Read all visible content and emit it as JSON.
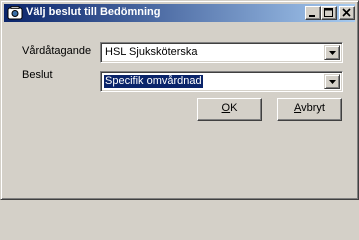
{
  "window": {
    "title": "Välj beslut till Bedömning",
    "controls": {
      "minimize_icon": "minimize-icon",
      "maximize_icon": "maximize-icon",
      "close_icon": "close-icon"
    }
  },
  "form": {
    "vardatagande": {
      "label": "Vårdåtagande",
      "value": "HSL Sjuksköterska"
    },
    "beslut": {
      "label": "Beslut",
      "value": "Specifik omvårdnad"
    }
  },
  "buttons": {
    "ok": {
      "mnemonic": "O",
      "rest": "K"
    },
    "avbryt": {
      "mnemonic": "A",
      "rest": "vbryt"
    }
  },
  "colors": {
    "title_start": "#0a246a",
    "title_end": "#a6caf0",
    "face": "#d4d0c8",
    "selection": "#0a246a"
  }
}
